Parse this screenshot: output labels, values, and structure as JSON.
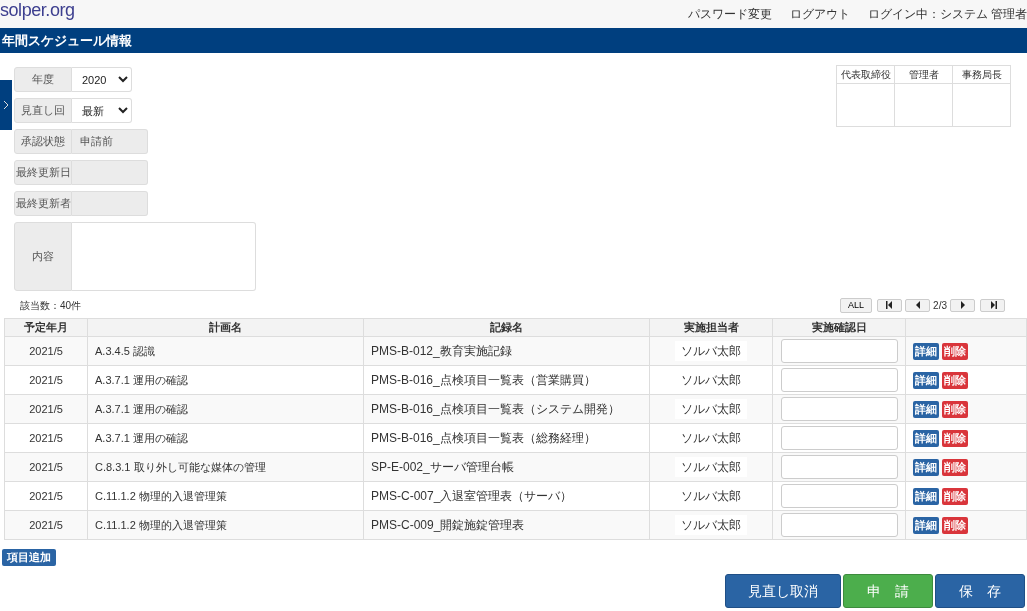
{
  "header": {
    "logo": "solper.org",
    "links": [
      "パスワード変更",
      "ログアウト"
    ],
    "user": "ログイン中：システム 管理者"
  },
  "title": "年間スケジュール情報",
  "form": [
    {
      "label": "年度",
      "kind": "select",
      "value": "2020"
    },
    {
      "label": "見直し回",
      "kind": "select",
      "value": "最新"
    },
    {
      "label": "承認状態",
      "kind": "readonly",
      "value": "申請前"
    },
    {
      "label": "最終更新日",
      "kind": "readonly"
    },
    {
      "label": "最終更新者",
      "kind": "readonly"
    },
    {
      "label": "内容",
      "kind": "textarea"
    }
  ],
  "approvals": {
    "columns": [
      "代表取締役",
      "管理者",
      "事務局長"
    ]
  },
  "count": "該当数：40件",
  "pager": {
    "all": "ALL",
    "page": "2/3"
  },
  "table": {
    "columns": [
      "予定年月",
      "計画名",
      "記録名",
      "実施担当者",
      "実施確認日"
    ],
    "rows": [
      {
        "month": "2021/5",
        "plan": "A.3.4.5 認識",
        "record": "PMS-B-012_教育実施記録",
        "person": "ソルバ太郎",
        "detail": "詳細",
        "delete": "削除"
      },
      {
        "month": "2021/5",
        "plan": "A.3.7.1 運用の確認",
        "record": "PMS-B-016_点検項目一覧表（営業購買）",
        "person": "ソルバ太郎",
        "detail": "詳細",
        "delete": "削除"
      },
      {
        "month": "2021/5",
        "plan": "A.3.7.1 運用の確認",
        "record": "PMS-B-016_点検項目一覧表（システム開発）",
        "person": "ソルバ太郎",
        "detail": "詳細",
        "delete": "削除"
      },
      {
        "month": "2021/5",
        "plan": "A.3.7.1 運用の確認",
        "record": "PMS-B-016_点検項目一覧表（総務経理）",
        "person": "ソルバ太郎",
        "detail": "詳細",
        "delete": "削除"
      },
      {
        "month": "2021/5",
        "plan": "C.8.3.1 取り外し可能な媒体の管理",
        "record": "SP-E-002_サーバ管理台帳",
        "person": "ソルバ太郎",
        "detail": "詳細",
        "delete": "削除"
      },
      {
        "month": "2021/5",
        "plan": "C.11.1.2 物理的入退管理策",
        "record": "PMS-C-007_入退室管理表（サーバ）",
        "person": "ソルバ太郎",
        "detail": "詳細",
        "delete": "削除"
      },
      {
        "month": "2021/5",
        "plan": "C.11.1.2 物理的入退管理策",
        "record": "PMS-C-009_開錠施錠管理表",
        "person": "ソルバ太郎",
        "detail": "詳細",
        "delete": "削除"
      }
    ]
  },
  "add_button": "項目追加",
  "actions": [
    {
      "label": "見直し取消",
      "kind": "primary"
    },
    {
      "label": "申　請",
      "kind": "success"
    },
    {
      "label": "保　存",
      "kind": "primary"
    }
  ]
}
